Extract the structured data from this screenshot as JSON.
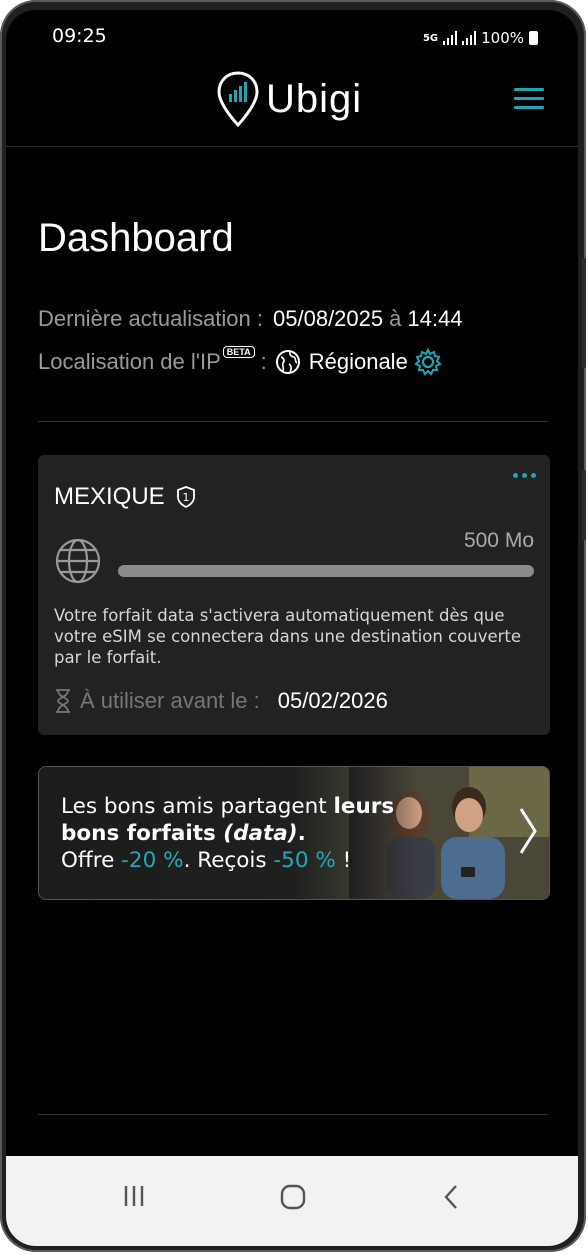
{
  "status_bar": {
    "time": "09:25",
    "network": "5G",
    "battery": "100%"
  },
  "header": {
    "logo_text": "Ubigi",
    "menu_icon": "hamburger-menu-icon"
  },
  "dashboard": {
    "title": "Dashboard",
    "last_update_label": "Dernière actualisation :",
    "last_update_date": "05/08/2025",
    "last_update_sep": "à",
    "last_update_time": "14:44",
    "ip_label": "Localisation de l'IP",
    "ip_badge": "BETA",
    "ip_colon": ":",
    "ip_value": "Régionale",
    "settings_icon": "gear-icon"
  },
  "plan_card": {
    "country": "MEXIQUE",
    "badge_icon": "shield-number-icon",
    "badge_number": "1",
    "more_icon": "more-dots-icon",
    "quota": "500 Mo",
    "usage_fraction": 1.0,
    "description": "Votre forfait data s'activera automatiquement dès que votre eSIM se connectera dans une destination couverte par le forfait.",
    "expiry_label": "À utiliser avant le :",
    "expiry_date": "05/02/2026"
  },
  "promo": {
    "line1_regular": "Les bons amis partagent ",
    "line1_bold": "leurs",
    "line2_bold": "bons forfaits ",
    "line2_italic": "(data)",
    "line2_end": ".",
    "line3_a": "Offre ",
    "line3_discount1": "-20 %",
    "line3_b": ". Reçois ",
    "line3_discount2": "-50 %",
    "line3_c": " !",
    "accent_color": "#22a9b7"
  },
  "nav_bar": {
    "recent_icon": "recent-apps-icon",
    "home_icon": "home-icon",
    "back_icon": "back-icon"
  },
  "colors": {
    "accent": "#1ea6b4",
    "background": "#000000",
    "card": "#222222"
  }
}
